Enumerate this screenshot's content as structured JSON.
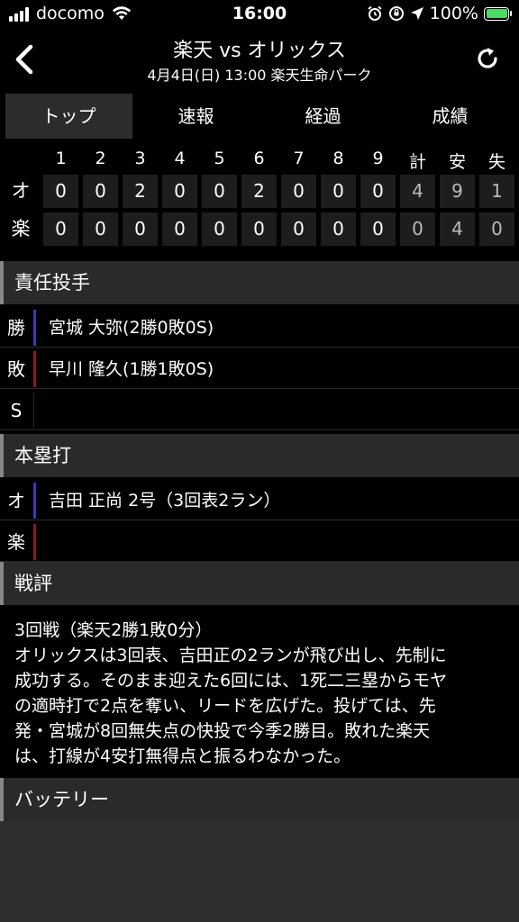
{
  "status_bar": {
    "carrier": "docomo",
    "time": "16:00",
    "battery": "100%"
  },
  "nav": {
    "title": "楽天 vs オリックス",
    "subtitle": "4月4日(日) 13:00 楽天生命パーク"
  },
  "tabs": [
    "トップ",
    "速報",
    "経過",
    "成績"
  ],
  "active_tab": "トップ",
  "scoreboard": {
    "headers": [
      "1",
      "2",
      "3",
      "4",
      "5",
      "6",
      "7",
      "8",
      "9",
      "計",
      "安",
      "失"
    ],
    "teams": [
      {
        "label": "オ",
        "scores": [
          "0",
          "0",
          "2",
          "0",
          "0",
          "2",
          "0",
          "0",
          "0",
          "4",
          "9",
          "1"
        ]
      },
      {
        "label": "楽",
        "scores": [
          "0",
          "0",
          "0",
          "0",
          "0",
          "0",
          "0",
          "0",
          "0",
          "0",
          "4",
          "0"
        ]
      }
    ]
  },
  "pitchers": {
    "section_title": "責任投手",
    "rows": [
      {
        "label": "勝",
        "text": "宮城 大弥(2勝0敗0S)"
      },
      {
        "label": "敗",
        "text": "早川 隆久(1勝1敗0S)"
      },
      {
        "label": "S",
        "text": ""
      }
    ]
  },
  "homeruns": {
    "section_title": "本塁打",
    "rows": [
      {
        "label": "オ",
        "text": "吉田 正尚 2号（3回表2ラン）"
      },
      {
        "label": "楽",
        "text": ""
      }
    ]
  },
  "review": {
    "section_title": "戦評",
    "lines": [
      "3回戦（楽天2勝1敗0分）",
      "オリックスは3回表、吉田正の2ランが飛び出し、先制に",
      "成功する。そのまま迎えた6回には、1死二三塁からモヤ",
      "の適時打で2点を奪い、リードを広げた。投げては、先",
      "発・宮城が8回無失点の快投で今季2勝目。敗れた楽天",
      "は、打線が4安打無得点と振るわなかった。"
    ]
  },
  "battery_section": {
    "section_title": "バッテリー"
  },
  "colors": {
    "visitor_stripe": "#3a3ab8",
    "home_stripe": "#8a1a2a",
    "battery_green": "#4cd964"
  }
}
